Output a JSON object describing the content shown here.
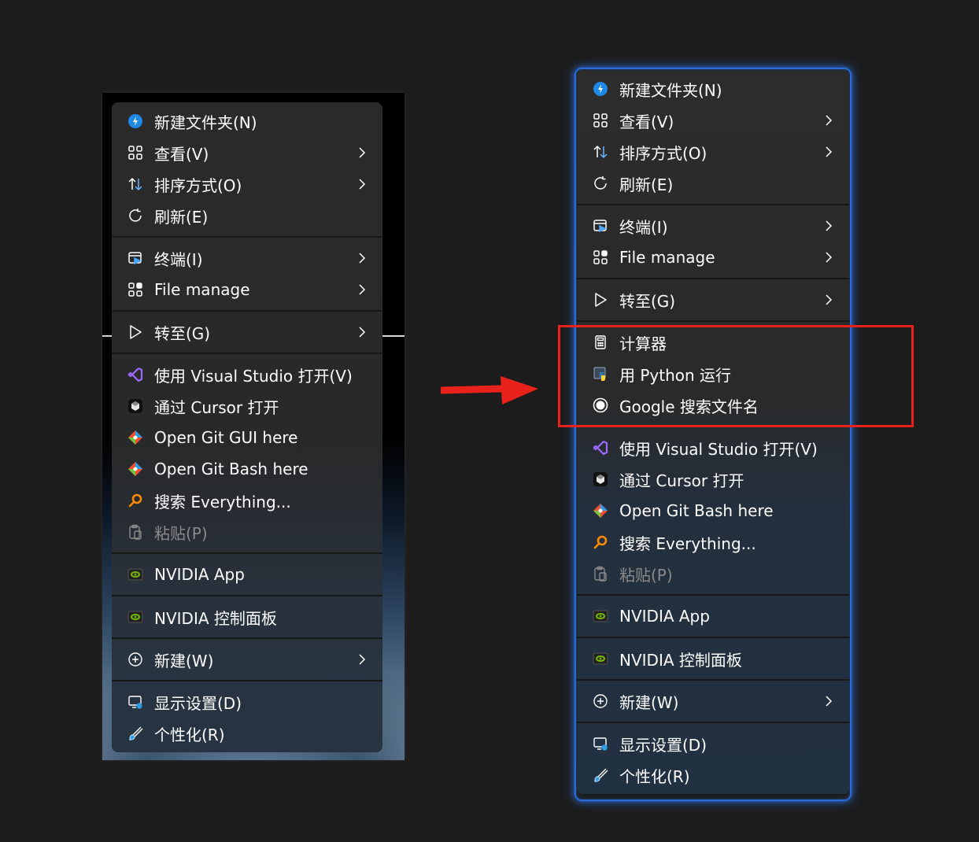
{
  "left_menu": {
    "items": [
      {
        "label": "新建文件夹(N)",
        "icon": "new-folder-icon",
        "submenu": false
      },
      {
        "label": "查看(V)",
        "icon": "view-grid-icon",
        "submenu": true
      },
      {
        "label": "排序方式(O)",
        "icon": "sort-icon",
        "submenu": true
      },
      {
        "label": "刷新(E)",
        "icon": "refresh-icon",
        "submenu": false
      },
      {
        "label": "终端(I)",
        "icon": "terminal-icon",
        "submenu": true
      },
      {
        "label": "File manage",
        "icon": "file-manage-icon",
        "submenu": true
      },
      {
        "label": "转至(G)",
        "icon": "goto-icon",
        "submenu": true
      },
      {
        "label": "使用 Visual Studio 打开(V)",
        "icon": "visual-studio-icon",
        "submenu": false
      },
      {
        "label": "通过 Cursor 打开",
        "icon": "cursor-app-icon",
        "submenu": false
      },
      {
        "label": "Open Git GUI here",
        "icon": "git-icon",
        "submenu": false
      },
      {
        "label": "Open Git Bash here",
        "icon": "git-icon",
        "submenu": false
      },
      {
        "label": "搜索 Everything...",
        "icon": "everything-search-icon",
        "submenu": false
      },
      {
        "label": "粘贴(P)",
        "icon": "paste-icon",
        "submenu": false,
        "disabled": true
      },
      {
        "label": "NVIDIA App",
        "icon": "nvidia-icon",
        "submenu": false
      },
      {
        "label": "NVIDIA 控制面板",
        "icon": "nvidia-icon",
        "submenu": false
      },
      {
        "label": "新建(W)",
        "icon": "new-plus-icon",
        "submenu": true
      },
      {
        "label": "显示设置(D)",
        "icon": "display-settings-icon",
        "submenu": false
      },
      {
        "label": "个性化(R)",
        "icon": "personalize-brush-icon",
        "submenu": false
      }
    ]
  },
  "right_menu": {
    "items": [
      {
        "label": "新建文件夹(N)",
        "icon": "new-folder-icon",
        "submenu": false
      },
      {
        "label": "查看(V)",
        "icon": "view-grid-icon",
        "submenu": true
      },
      {
        "label": "排序方式(O)",
        "icon": "sort-icon",
        "submenu": true
      },
      {
        "label": "刷新(E)",
        "icon": "refresh-icon",
        "submenu": false
      },
      {
        "label": "终端(I)",
        "icon": "terminal-icon",
        "submenu": true
      },
      {
        "label": "File manage",
        "icon": "file-manage-icon",
        "submenu": true
      },
      {
        "label": "转至(G)",
        "icon": "goto-icon",
        "submenu": true
      },
      {
        "label": "计算器",
        "icon": "calculator-icon",
        "submenu": false
      },
      {
        "label": "用 Python 运行",
        "icon": "python-icon",
        "submenu": false
      },
      {
        "label": "Google 搜索文件名",
        "icon": "google-search-icon",
        "submenu": false
      },
      {
        "label": "使用 Visual Studio 打开(V)",
        "icon": "visual-studio-icon",
        "submenu": false
      },
      {
        "label": "通过 Cursor 打开",
        "icon": "cursor-app-icon",
        "submenu": false
      },
      {
        "label": "Open Git Bash here",
        "icon": "git-icon",
        "submenu": false
      },
      {
        "label": "搜索 Everything...",
        "icon": "everything-search-icon",
        "submenu": false
      },
      {
        "label": "粘贴(P)",
        "icon": "paste-icon",
        "submenu": false,
        "disabled": true
      },
      {
        "label": "NVIDIA App",
        "icon": "nvidia-icon",
        "submenu": false
      },
      {
        "label": "NVIDIA 控制面板",
        "icon": "nvidia-icon",
        "submenu": false
      },
      {
        "label": "新建(W)",
        "icon": "new-plus-icon",
        "submenu": true
      },
      {
        "label": "显示设置(D)",
        "icon": "display-settings-icon",
        "submenu": false
      },
      {
        "label": "个性化(R)",
        "icon": "personalize-brush-icon",
        "submenu": false
      }
    ]
  },
  "colors": {
    "accent_blue": "#2c6cd8",
    "highlight_red": "#e8221b",
    "text": "#ffffff",
    "disabled_text": "#8a8a8a"
  }
}
